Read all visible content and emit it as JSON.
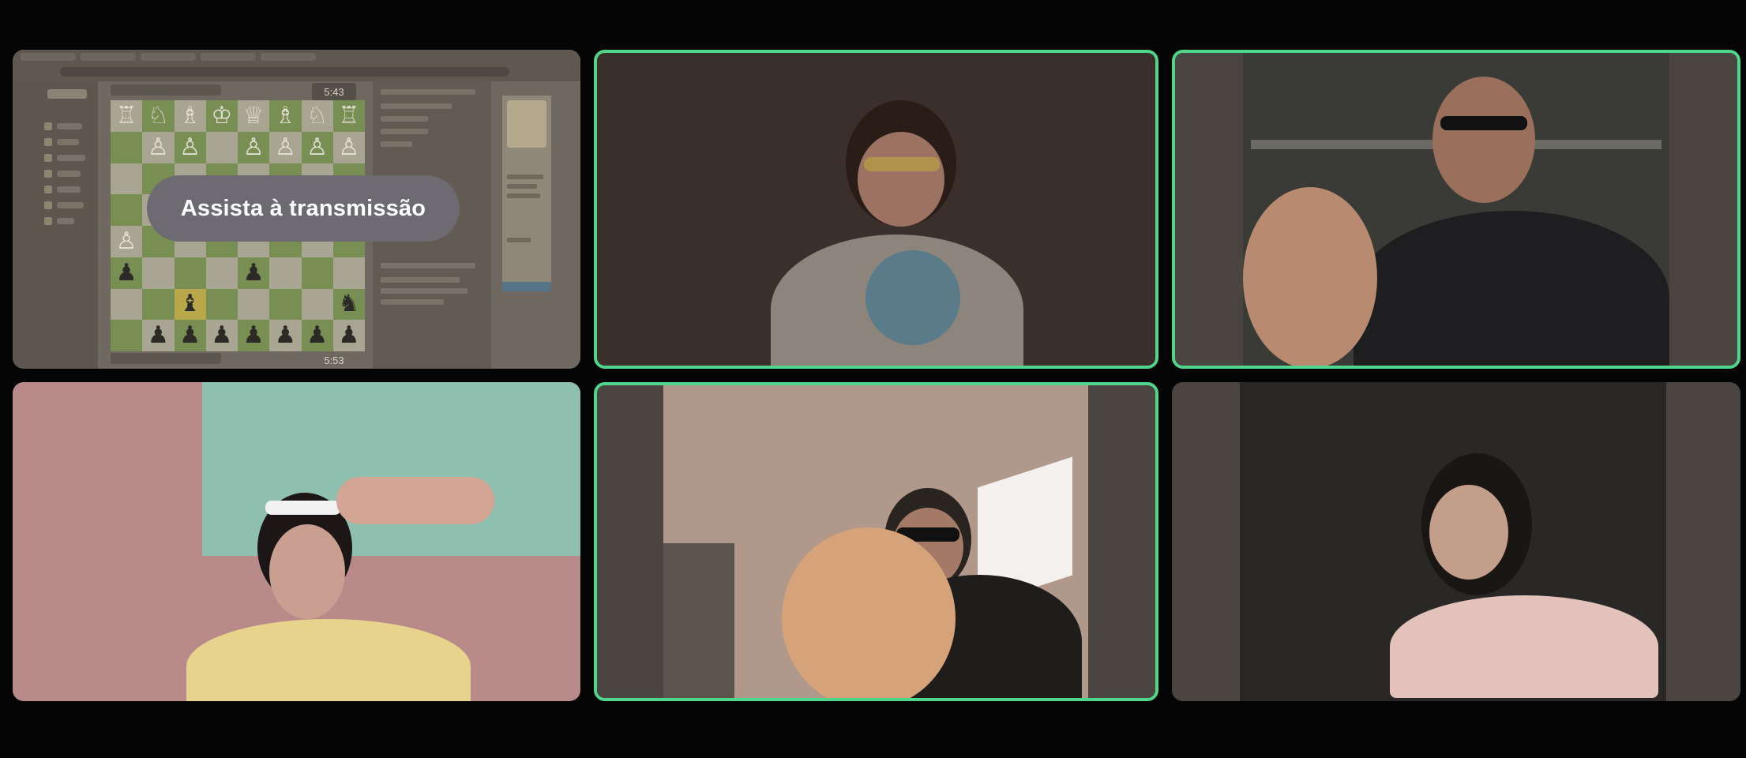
{
  "call": {
    "tiles": [
      {
        "id": "screen-share",
        "speaking": false
      },
      {
        "id": "participant-2",
        "speaking": true
      },
      {
        "id": "participant-3",
        "speaking": true
      },
      {
        "id": "participant-4",
        "speaking": false
      },
      {
        "id": "participant-5",
        "speaking": true
      },
      {
        "id": "participant-6",
        "speaking": false
      }
    ]
  },
  "screen_share": {
    "overlay_label": "Assista à transmissão",
    "clock_top": "5:43",
    "clock_bottom": "5:53"
  },
  "colors": {
    "background": "#050505",
    "speaking_border": "#4fd68a",
    "tile_bg": "#4a4540",
    "overlay_pill": "#6d6a72"
  },
  "icons": [
    "chess-pieces",
    "browser-tab",
    "speaker-indicator"
  ]
}
